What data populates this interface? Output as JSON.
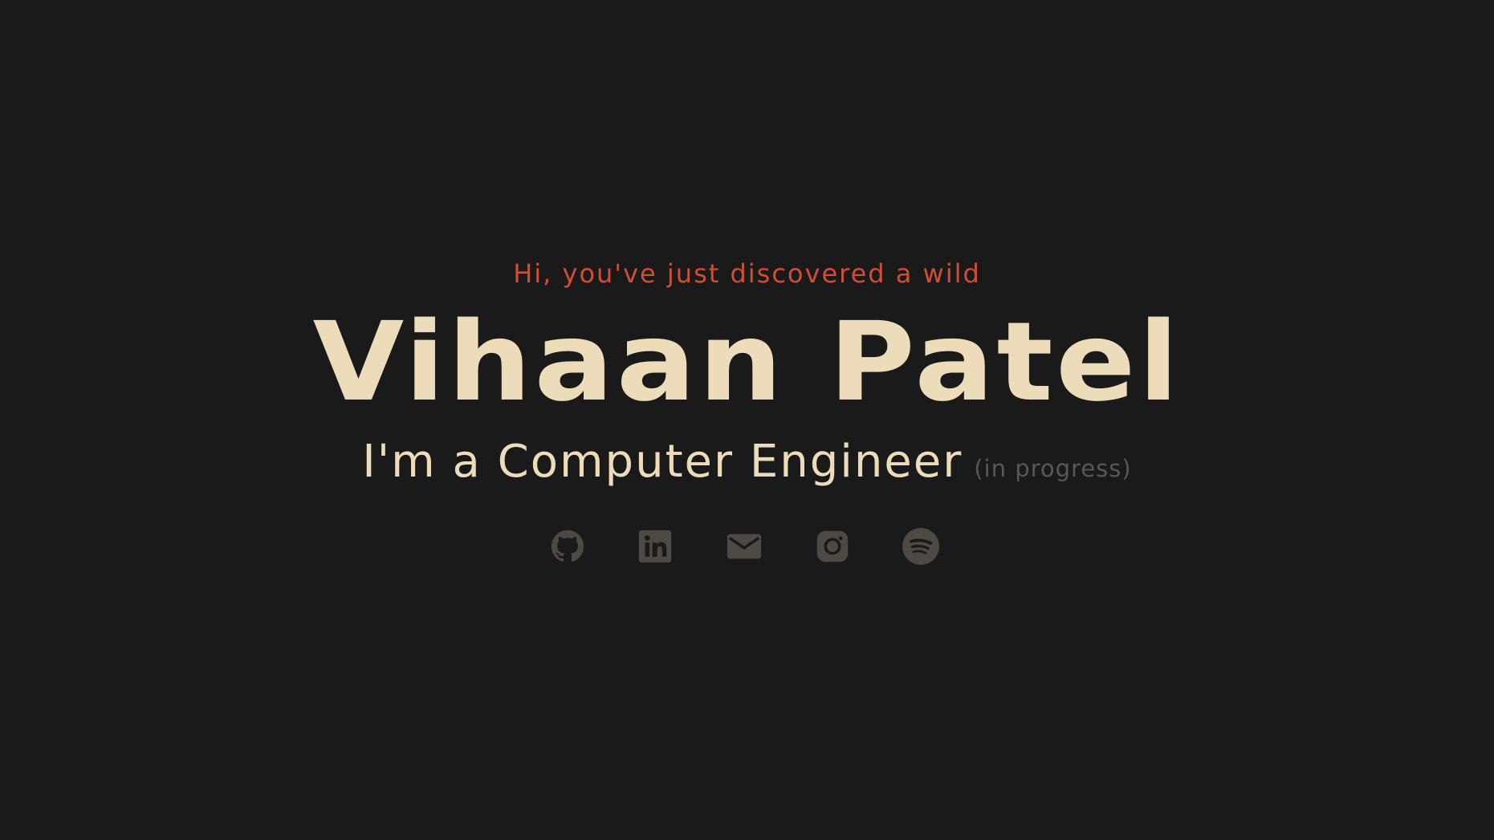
{
  "hero": {
    "intro": "Hi, you've just discovered a wild",
    "name": "Vihaan Patel",
    "role": "I'm a Computer Engineer",
    "note": "(in progress)"
  },
  "socials": [
    {
      "icon": "github-icon"
    },
    {
      "icon": "linkedin-icon"
    },
    {
      "icon": "mail-icon"
    },
    {
      "icon": "instagram-icon"
    },
    {
      "icon": "spotify-icon"
    }
  ],
  "colors": {
    "background": "#1a1a1a",
    "accent": "#cf4e35",
    "primary_text": "#ecdcb9",
    "muted_text": "#5b5852",
    "icon": "#4e4a43"
  }
}
